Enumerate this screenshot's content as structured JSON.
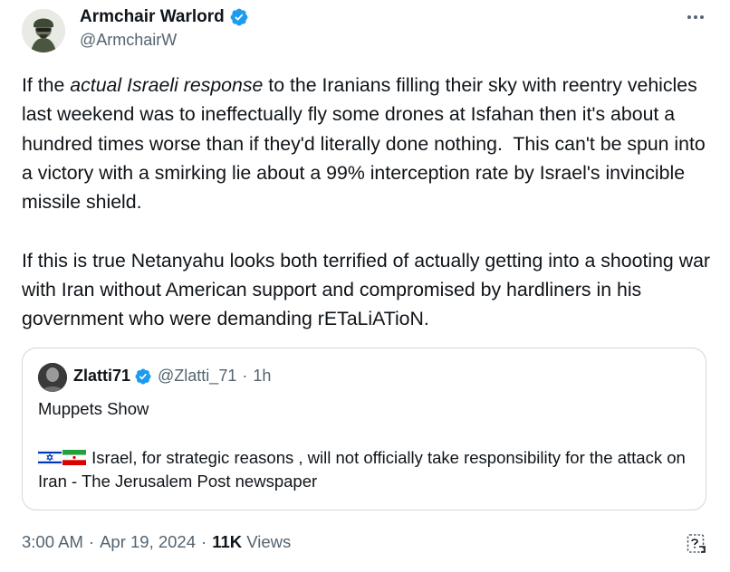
{
  "author": {
    "display_name": "Armchair Warlord",
    "handle": "@ArmchairW",
    "verified": true
  },
  "tweet": {
    "p1_before": "If the ",
    "p1_italic": "actual Israeli response",
    "p1_after": " to the Iranians filling their sky with reentry vehicles last weekend was to ineffectually fly some drones at Isfahan then it's about a hundred times worse than if they'd literally done nothing.  This can't be spun into a victory with a smirking lie about a 99% interception rate by Israel's invincible missile shield.",
    "p2": "If this is true Netanyahu looks both terrified of actually getting into a shooting war with Iran without American support and compromised by hardliners in his government who were demanding rETaLiATioN."
  },
  "quoted": {
    "display_name": "Zlatti71",
    "handle": "@Zlatti_71",
    "separator": "·",
    "time": "1h",
    "line1": "Muppets Show",
    "line2": "Israel, for strategic reasons , will not officially take responsibility for the attack on Iran - The Jerusalem Post newspaper",
    "flags": [
      "israel-flag-icon",
      "iran-flag-icon"
    ]
  },
  "footer": {
    "time": "3:00 AM",
    "dot": "·",
    "date": "Apr 19, 2024",
    "views_count": "11K",
    "views_label": "Views"
  },
  "colors": {
    "text": "#0f1419",
    "secondary": "#536471",
    "verified_blue": "#1d9bf0",
    "border": "#cfd9de"
  }
}
